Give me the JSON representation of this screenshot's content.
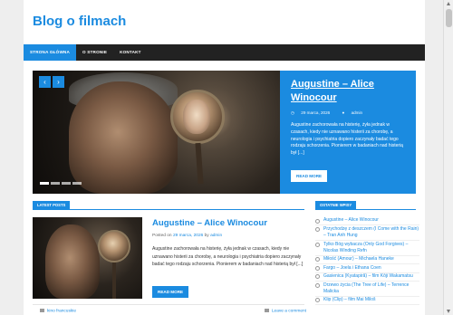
{
  "site": {
    "title": "Blog o filmach"
  },
  "nav": {
    "items": [
      {
        "label": "STRONA GŁÓWNA",
        "active": true
      },
      {
        "label": "O STRONIE",
        "active": false
      },
      {
        "label": "KONTAKT",
        "active": false
      }
    ]
  },
  "slider": {
    "prev_icon": "‹",
    "next_icon": "›",
    "title": "Augustine – Alice Winocour",
    "date": "29 marca, 2026",
    "author": "admin",
    "excerpt": "Augustine zachorowała na histerię, żyła jednak w czasach, kiedy nie uznawano histerii za chorobę, a neurologia i psychiatria dopiero zaczynały badać tego rodzaju schorzenia. Pionierem w badaniach nad histerią był [...]",
    "button": "READ MORE",
    "dots": 4,
    "active_dot": 1
  },
  "latest": {
    "heading": "LATEST POSTS",
    "post": {
      "title": "Augustine – Alice Winocour",
      "posted_on": "Posted on",
      "date": "29 marca, 2026",
      "by": "by",
      "author": "admin",
      "excerpt": "Augustine zachorowała na histerię, żyła jednak w czasach, kiedy nie uznawano histerii za chorobę, a neurologia i psychiatria dopiero zaczynały badać tego rodzaju schorzenia. Pionierem w badaniach nad histerią był [...]",
      "button": "READ MORE",
      "category": "kino francuskie",
      "comment": "Leave a comment"
    }
  },
  "sidebar": {
    "heading": "OSTATNIE WPISY",
    "items": [
      "Augustine – Alice Winocour",
      "Przychodzę z deszczem (I Come with the Rain) – Tran Anh Hung",
      "Tylko Bóg wybacza (Only God Forgives) – Nicolas Winding Refn",
      "Miłość (Amour) – Michaela Haneke",
      "Fargo – Joela i Ethana Coen",
      "Gasienica (Kyatapiră) – film Kōji Wakamatsu",
      "Drzewo życia (The Tree of Life) – Terrence Malicka",
      "Klip (Clip) – film Mai Miloš"
    ]
  },
  "colors": {
    "accent": "#1b8be0",
    "nav_bg": "#222222"
  }
}
